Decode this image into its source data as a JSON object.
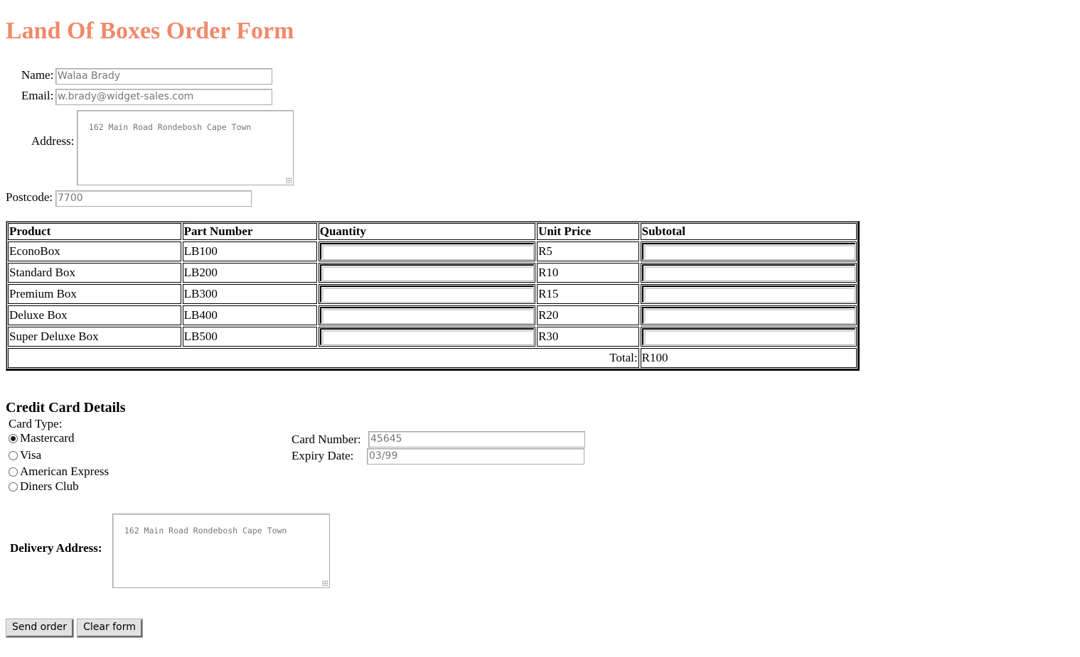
{
  "page": {
    "title": "Land Of Boxes Order Form",
    "accent_color": "#f0896b"
  },
  "customer": {
    "name_label": "Name:",
    "name_value": "Walaa Brady",
    "email_label": "Email:",
    "email_value": "w.brady@widget-sales.com",
    "address_label": "Address:",
    "address_value": "162 Main Road Rondebosh Cape Town",
    "postcode_label": "Postcode:",
    "postcode_value": "7700"
  },
  "order_table": {
    "headers": [
      "Product",
      "Part Number",
      "Quantity",
      "Unit Price",
      "Subtotal"
    ],
    "rows": [
      {
        "product": "EconoBox",
        "part": "LB100",
        "quantity": "",
        "price": "R5",
        "subtotal": ""
      },
      {
        "product": "Standard Box",
        "part": "LB200",
        "quantity": "",
        "price": "R10",
        "subtotal": ""
      },
      {
        "product": "Premium Box",
        "part": "LB300",
        "quantity": "",
        "price": "R15",
        "subtotal": ""
      },
      {
        "product": "Deluxe Box",
        "part": "LB400",
        "quantity": "",
        "price": "R20",
        "subtotal": ""
      },
      {
        "product": "Super Deluxe Box",
        "part": "LB500",
        "quantity": "",
        "price": "R30",
        "subtotal": ""
      }
    ],
    "total_label": "Total:",
    "total_value": "R100"
  },
  "credit_card": {
    "heading": "Credit Card Details",
    "card_type_label": "Card Type:",
    "card_types": [
      {
        "label": "Mastercard",
        "checked": true
      },
      {
        "label": "Visa",
        "checked": false
      },
      {
        "label": "American Express",
        "checked": false
      },
      {
        "label": "Diners Club",
        "checked": false
      }
    ],
    "card_number_label": "Card Number:",
    "card_number_value": "45645",
    "expiry_label": "Expiry Date:",
    "expiry_value": "03/99"
  },
  "delivery": {
    "label": "Delivery Address:",
    "value": "162 Main Road Rondebosh Cape Town"
  },
  "actions": {
    "send_label": "Send order",
    "clear_label": "Clear form"
  }
}
